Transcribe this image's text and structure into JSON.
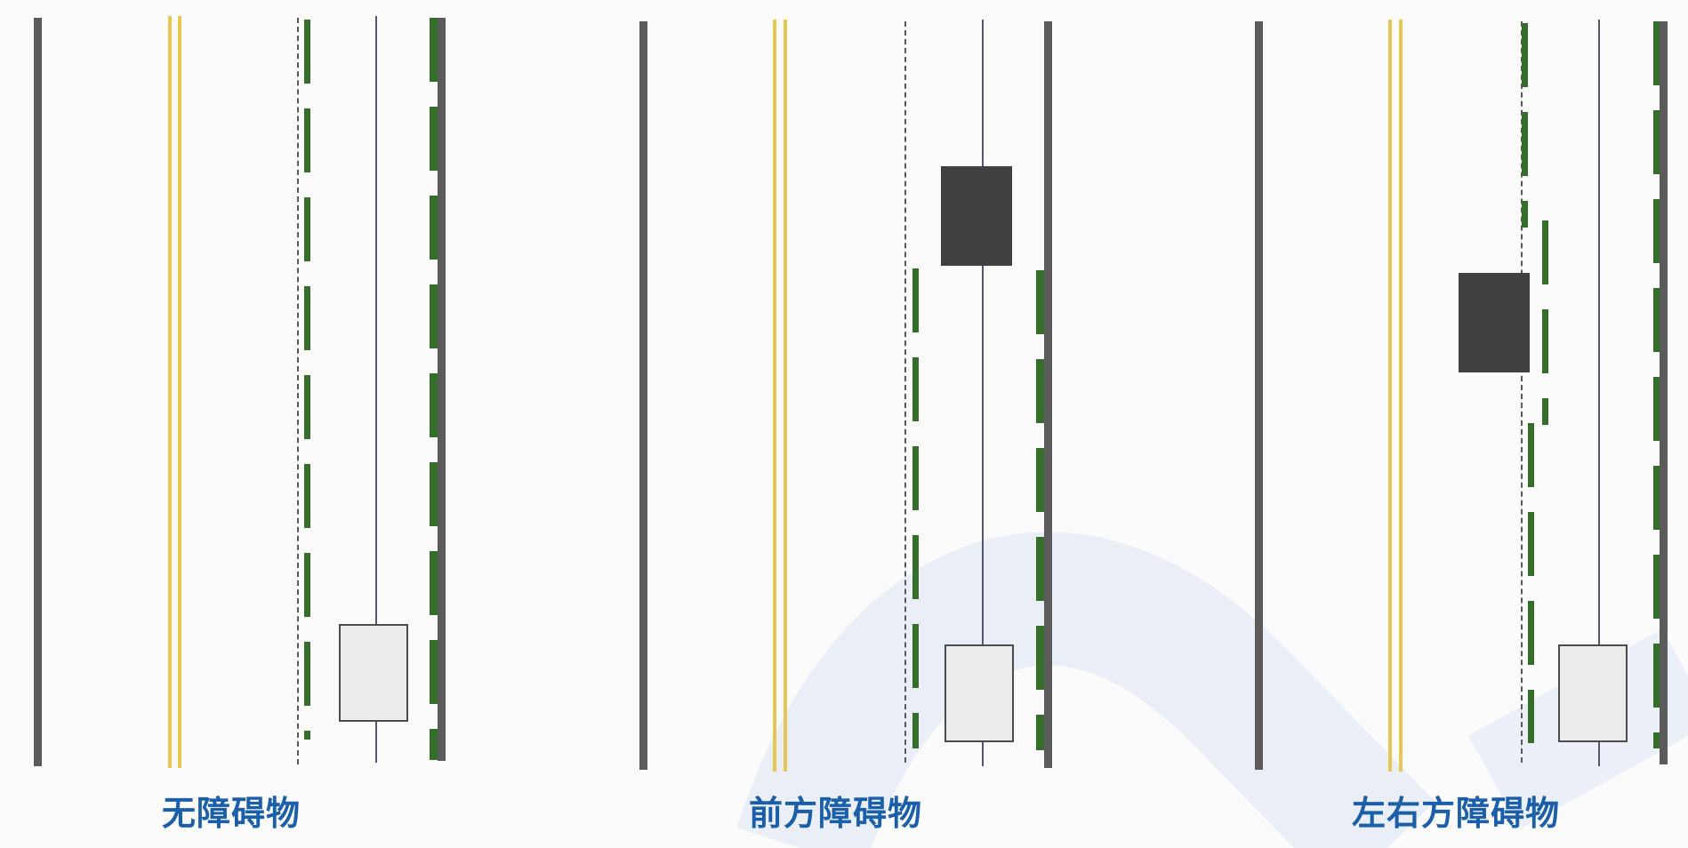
{
  "scenes": [
    {
      "caption": "无障碍物"
    },
    {
      "caption": "前方障碍物"
    },
    {
      "caption": "左右方障碍物"
    }
  ],
  "colors": {
    "road_edge": "#5b5b5b",
    "center_yellow": "#e8c652",
    "lane_green": "#356e2b",
    "obstacle": "#404040",
    "ego_vehicle": "#ececec",
    "caption": "#1b5fa8"
  }
}
